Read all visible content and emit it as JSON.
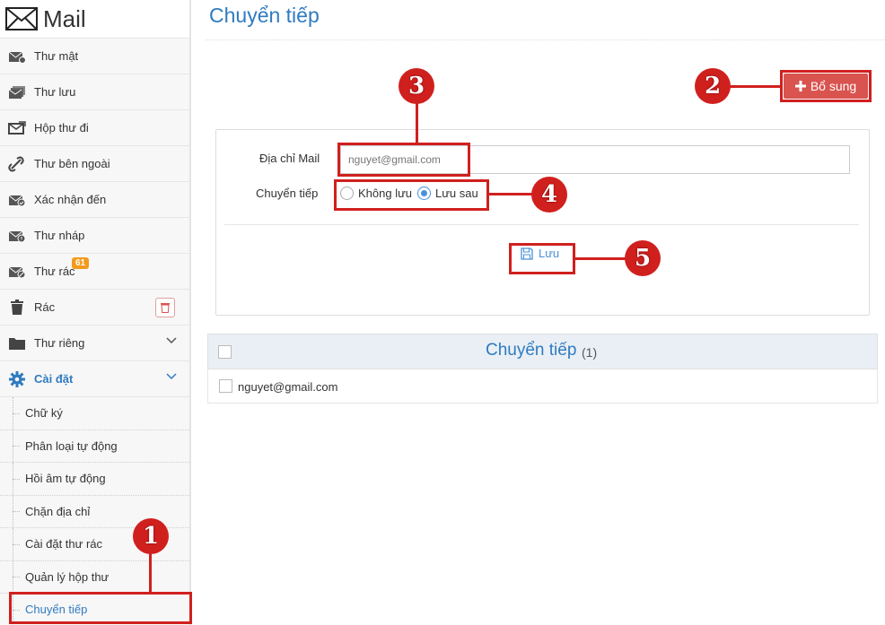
{
  "app": {
    "title": "Mail"
  },
  "sidebar": {
    "items": [
      {
        "label": "Thư mật",
        "icon": "secret-mail-icon"
      },
      {
        "label": "Thư lưu",
        "icon": "archive-mail-icon"
      },
      {
        "label": "Hộp thư đi",
        "icon": "outbox-icon"
      },
      {
        "label": "Thư bên ngoài",
        "icon": "external-mail-icon"
      },
      {
        "label": "Xác nhận đến",
        "icon": "confirm-mail-icon"
      },
      {
        "label": "Thư nháp",
        "icon": "draft-mail-icon"
      },
      {
        "label": "Thư rác",
        "icon": "spam-mail-icon",
        "badge": "61"
      },
      {
        "label": "Rác",
        "icon": "trash-icon"
      },
      {
        "label": "Thư riêng",
        "icon": "folder-icon"
      },
      {
        "label": "Cài đặt",
        "icon": "gear-icon"
      }
    ],
    "settings": [
      "Chữ ký",
      "Phân loại tự động",
      "Hồi âm tự động",
      "Chặn địa chỉ",
      "Cài đặt thư rác",
      "Quản lý hộp thư",
      "Chuyển tiếp"
    ]
  },
  "main": {
    "title": "Chuyển tiếp",
    "add_label": "Bổ sung",
    "form": {
      "mail_label": "Địa chỉ Mail",
      "mail_value": "nguyet@gmail.com",
      "forward_label": "Chuyển tiếp",
      "option_no_save": "Không lưu",
      "option_save": "Lưu sau",
      "save_label": "Lưu"
    },
    "list": {
      "title": "Chuyển tiếp",
      "count": "(1)",
      "rows": [
        "nguyet@gmail.com"
      ]
    }
  },
  "annotations": [
    "1",
    "2",
    "3",
    "4",
    "5"
  ],
  "colors": {
    "accent": "#2f7bc0",
    "danger": "#d9534f",
    "annotation": "#d0201e",
    "badge": "#f39a1d"
  }
}
